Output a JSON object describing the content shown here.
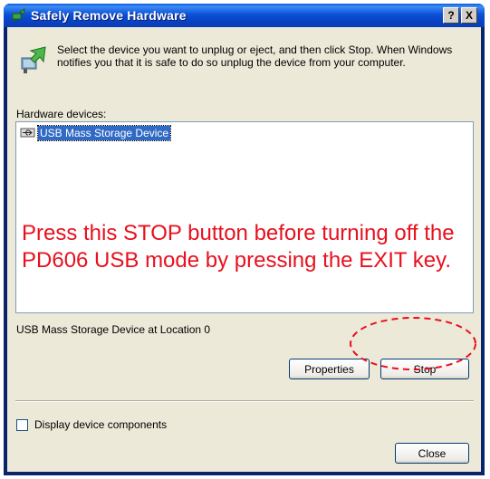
{
  "window": {
    "title": "Safely Remove Hardware",
    "help_button": "?",
    "close_button": "X"
  },
  "description": "Select the device you want to unplug or eject, and then click Stop. When Windows notifies you that it is safe to do so unplug the device from your computer.",
  "hardware_label": "Hardware devices:",
  "devices": [
    {
      "label": "USB Mass Storage Device",
      "icon": "usb-device-icon",
      "selected": true
    }
  ],
  "annotation": {
    "text": "Press this STOP button before turning off the PD606 USB mode by pressing the EXIT key.",
    "color": "#e8101e"
  },
  "location_text": "USB Mass Storage Device at Location 0",
  "buttons": {
    "properties": "Properties",
    "stop": "Stop",
    "close": "Close"
  },
  "checkbox": {
    "label": "Display device components",
    "checked": false
  },
  "colors": {
    "titlebar": "#0a52d8",
    "selection": "#316ac5",
    "annotation_ring": "#e8101e"
  }
}
